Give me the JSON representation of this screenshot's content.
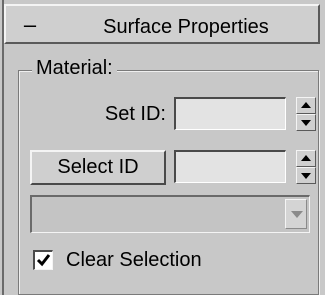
{
  "rollout": {
    "toggle": "–",
    "title": "Surface Properties"
  },
  "material_group": {
    "label": "Material:",
    "set_id": {
      "label": "Set ID:",
      "value": ""
    },
    "select_id": {
      "button_label": "Select ID",
      "value": ""
    },
    "dropdown": {
      "selected": ""
    },
    "clear_selection": {
      "label": "Clear Selection",
      "checked": true
    }
  },
  "icons": {
    "spinner": "up-down-spinner-icon",
    "dropdown": "chevron-down-icon",
    "check": "checkmark-icon"
  }
}
